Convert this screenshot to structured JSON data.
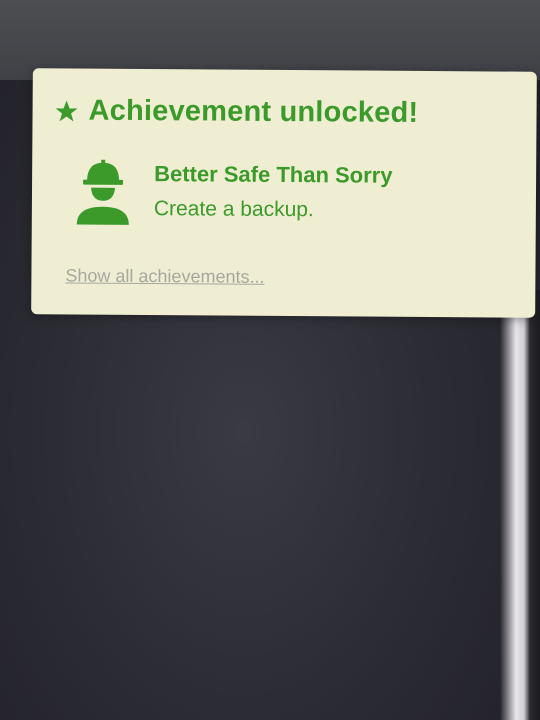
{
  "toast": {
    "title": "Achievement unlocked!",
    "header_icon": "star-icon",
    "achievement": {
      "icon": "worker-helmet-icon",
      "name": "Better Safe Than Sorry",
      "description": "Create a backup."
    },
    "link_label": "Show all achievements..."
  },
  "colors": {
    "toast_background": "#efeed3",
    "accent_green": "#3c9a2a",
    "link_gray": "#a6a8a0",
    "backdrop": "#2c2c34"
  }
}
